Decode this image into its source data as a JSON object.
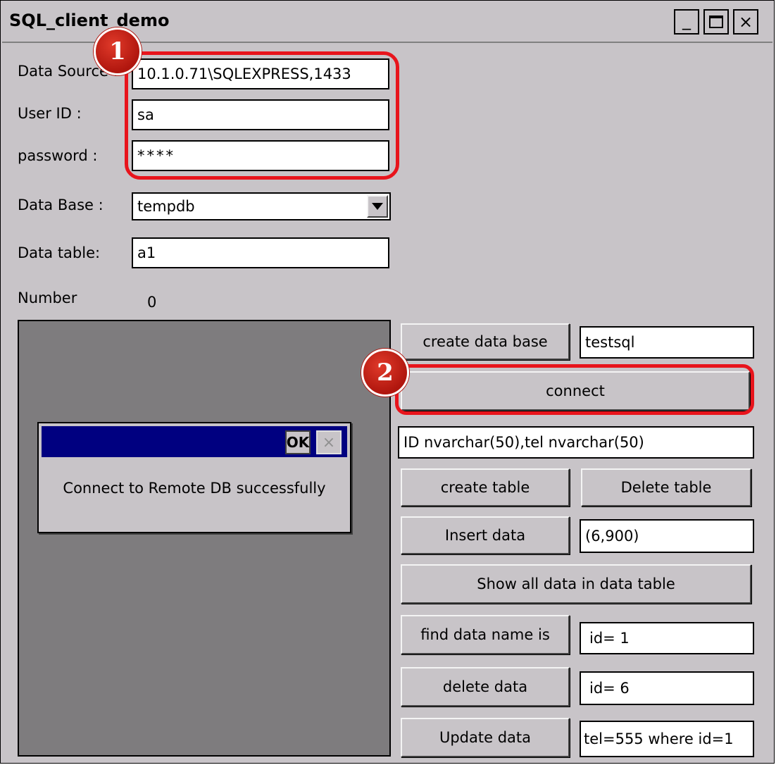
{
  "window": {
    "title": "SQL_client_demo",
    "controls": {
      "minimize": "_",
      "maximize": "□",
      "close": "×"
    }
  },
  "form": {
    "data_source_label": "Data Source :",
    "data_source_value": "10.1.0.71\\SQLEXPRESS,1433",
    "user_id_label": "User ID :",
    "user_id_value": "sa",
    "password_label": "password :",
    "password_value": "****",
    "database_label": "Data Base :",
    "database_value": "tempdb",
    "data_table_label": "Data table:",
    "data_table_value": "a1",
    "number_label": "Number",
    "number_value": "0"
  },
  "actions": {
    "create_database_button": "create data base",
    "create_database_value": "testsql",
    "connect_button": "connect",
    "columns_value": "ID nvarchar(50),tel nvarchar(50)",
    "create_table_button": "create table",
    "delete_table_button": "Delete table",
    "insert_data_button": "Insert data",
    "insert_data_value": "(6,900)",
    "show_all_button": "Show all data in data table",
    "find_data_button": "find data name is",
    "find_data_value": "id= 1",
    "delete_data_button": "delete data",
    "delete_data_value": "id= 6",
    "update_data_button": "Update data",
    "update_data_value": "tel=555 where id=1"
  },
  "dialog": {
    "ok_label": "OK",
    "close_label": "×",
    "message": "Connect to Remote DB successfully"
  },
  "annotations": {
    "badge_1": "1",
    "badge_2": "2",
    "highlight_color": "#e8141c"
  }
}
